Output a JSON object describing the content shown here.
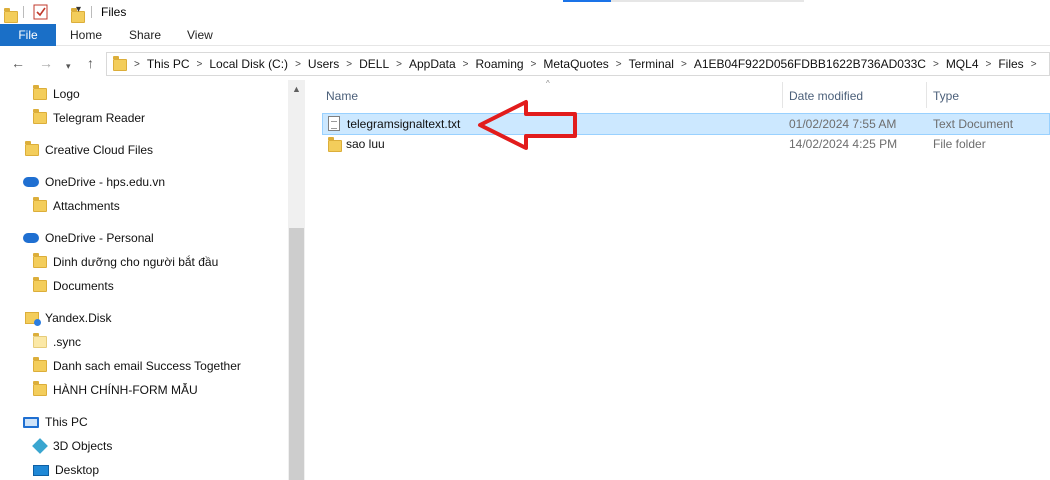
{
  "window": {
    "title": "Files"
  },
  "ribbon": {
    "tabs": [
      "File",
      "Home",
      "Share",
      "View"
    ]
  },
  "address": {
    "crumbs": [
      "This PC",
      "Local Disk (C:)",
      "Users",
      "DELL",
      "AppData",
      "Roaming",
      "MetaQuotes",
      "Terminal",
      "A1EB04F922D056FDBB1622B736AD033C",
      "MQL4",
      "Files"
    ]
  },
  "nav": {
    "items": [
      {
        "label": "Logo",
        "icon": "folder-icon"
      },
      {
        "label": "Telegram Reader",
        "icon": "folder-icon"
      },
      {
        "label": "Creative Cloud Files",
        "icon": "folder-icon"
      },
      {
        "label": "OneDrive - hps.edu.vn",
        "icon": "cloud-icon"
      },
      {
        "label": "Attachments",
        "icon": "folder-icon"
      },
      {
        "label": "OneDrive - Personal",
        "icon": "cloud-icon"
      },
      {
        "label": "Dinh dưỡng cho người bắt đầu",
        "icon": "folder-icon"
      },
      {
        "label": "Documents",
        "icon": "folder-icon"
      },
      {
        "label": "Yandex.Disk",
        "icon": "yandex-folder-icon"
      },
      {
        "label": ".sync",
        "icon": "folder-icon"
      },
      {
        "label": "Danh sach email Success Together",
        "icon": "folder-icon"
      },
      {
        "label": "HÀNH CHÍNH-FORM MẪU",
        "icon": "folder-icon"
      },
      {
        "label": "This PC",
        "icon": "pc-icon"
      },
      {
        "label": "3D Objects",
        "icon": "3d-objects-icon"
      },
      {
        "label": "Desktop",
        "icon": "desktop-icon"
      }
    ]
  },
  "columns": {
    "name": "Name",
    "date": "Date modified",
    "type": "Type"
  },
  "files": [
    {
      "name": "telegramsignaltext.txt",
      "date": "01/02/2024 7:55 AM",
      "type": "Text Document",
      "icon": "text-file-icon"
    },
    {
      "name": "sao luu",
      "date": "14/02/2024 4:25 PM",
      "type": "File folder",
      "icon": "folder-icon"
    }
  ],
  "colors": {
    "accent": "#1a6fc7",
    "selection": "#cce8ff",
    "arrow": "#e21c1c"
  }
}
